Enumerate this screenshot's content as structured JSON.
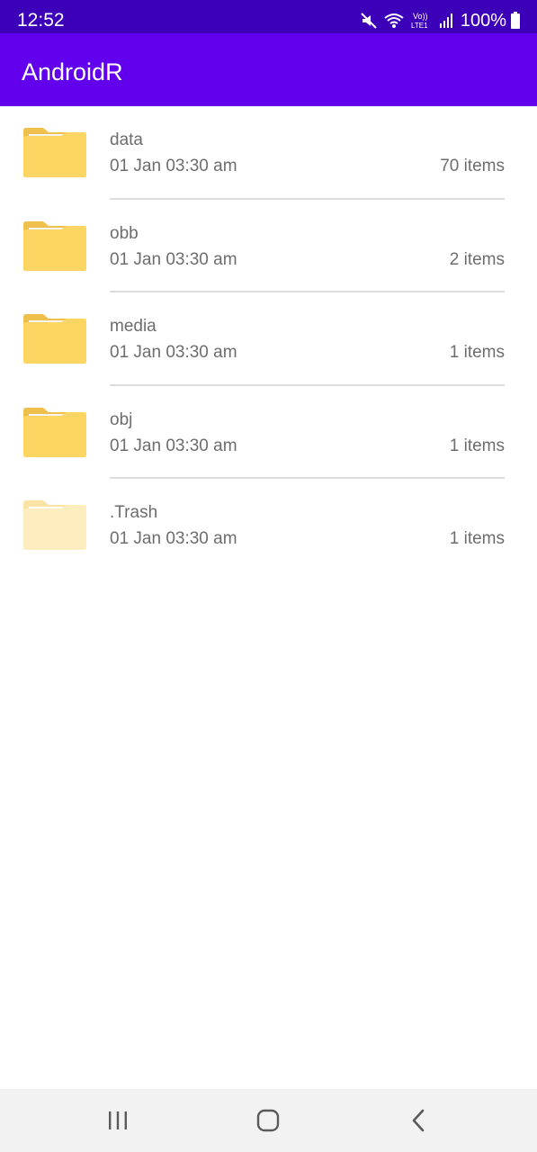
{
  "status_bar": {
    "time": "12:52",
    "battery": "100%",
    "icons": [
      "mute-icon",
      "wifi-icon",
      "volte-icon",
      "signal-icon",
      "battery-icon"
    ],
    "volte_label": "Vo)) LTE1"
  },
  "app_bar": {
    "title": "AndroidR",
    "color": "#6200ee"
  },
  "files": [
    {
      "name": "data",
      "date": "01 Jan 03:30 am",
      "count": "70 items",
      "faded": false
    },
    {
      "name": "obb",
      "date": "01 Jan 03:30 am",
      "count": "2 items",
      "faded": false
    },
    {
      "name": "media",
      "date": "01 Jan 03:30 am",
      "count": "1 items",
      "faded": false
    },
    {
      "name": "obj",
      "date": "01 Jan 03:30 am",
      "count": "1 items",
      "faded": false
    },
    {
      "name": ".Trash",
      "date": "01 Jan 03:30 am",
      "count": "1 items",
      "faded": true
    }
  ],
  "nav_bar": {
    "buttons": [
      "recents-icon",
      "home-icon",
      "back-icon"
    ]
  },
  "colors": {
    "status_bar": "#3b00b8",
    "folder": "#fdd562",
    "folder_faded": "#feedbf",
    "text": "#6d6d6d"
  }
}
